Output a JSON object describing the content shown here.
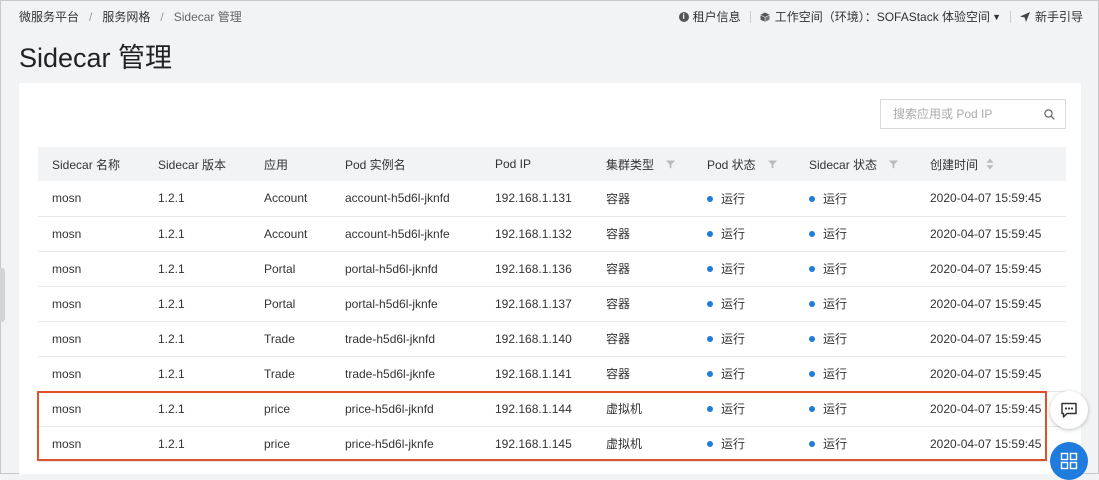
{
  "breadcrumb": {
    "items": [
      "微服务平台",
      "服务网格"
    ],
    "current": "Sidecar 管理",
    "separator": "/"
  },
  "topbar": {
    "tenant_info": "租户信息",
    "workspace_label": "工作空间（环境）：",
    "workspace_value": "SOFAStack 体验空间",
    "guide": "新手引导"
  },
  "page_title": "Sidecar 管理",
  "search": {
    "placeholder": "搜索应用或 Pod IP"
  },
  "table": {
    "columns": [
      "Sidecar 名称",
      "Sidecar 版本",
      "应用",
      "Pod 实例名",
      "Pod IP",
      "集群类型",
      "Pod 状态",
      "Sidecar 状态",
      "创建时间"
    ],
    "rows": [
      [
        "mosn",
        "1.2.1",
        "Account",
        "account-h5d6l-jknfd",
        "192.168.1.131",
        "容器",
        "运行",
        "运行",
        "2020-04-07 15:59:45"
      ],
      [
        "mosn",
        "1.2.1",
        "Account",
        "account-h5d6l-jknfe",
        "192.168.1.132",
        "容器",
        "运行",
        "运行",
        "2020-04-07 15:59:45"
      ],
      [
        "mosn",
        "1.2.1",
        "Portal",
        "portal-h5d6l-jknfd",
        "192.168.1.136",
        "容器",
        "运行",
        "运行",
        "2020-04-07 15:59:45"
      ],
      [
        "mosn",
        "1.2.1",
        "Portal",
        "portal-h5d6l-jknfe",
        "192.168.1.137",
        "容器",
        "运行",
        "运行",
        "2020-04-07 15:59:45"
      ],
      [
        "mosn",
        "1.2.1",
        "Trade",
        "trade-h5d6l-jknfd",
        "192.168.1.140",
        "容器",
        "运行",
        "运行",
        "2020-04-07 15:59:45"
      ],
      [
        "mosn",
        "1.2.1",
        "Trade",
        "trade-h5d6l-jknfe",
        "192.168.1.141",
        "容器",
        "运行",
        "运行",
        "2020-04-07 15:59:45"
      ],
      [
        "mosn",
        "1.2.1",
        "price",
        "price-h5d6l-jknfd",
        "192.168.1.144",
        "虚拟机",
        "运行",
        "运行",
        "2020-04-07 15:59:45"
      ],
      [
        "mosn",
        "1.2.1",
        "price",
        "price-h5d6l-jknfe",
        "192.168.1.145",
        "虚拟机",
        "运行",
        "运行",
        "2020-04-07 15:59:45"
      ]
    ]
  },
  "colors": {
    "status_dot": "#1f7bdc",
    "highlight_border": "#e0502c",
    "apps_button": "#1f7bdc"
  },
  "icons": {
    "tenant": "info-circle-icon",
    "workspace": "cube-icon",
    "guide": "send-icon",
    "search": "search-icon",
    "filter": "filter-icon",
    "sort": "sort-icon",
    "chat": "chat-icon",
    "apps": "apps-icon"
  }
}
